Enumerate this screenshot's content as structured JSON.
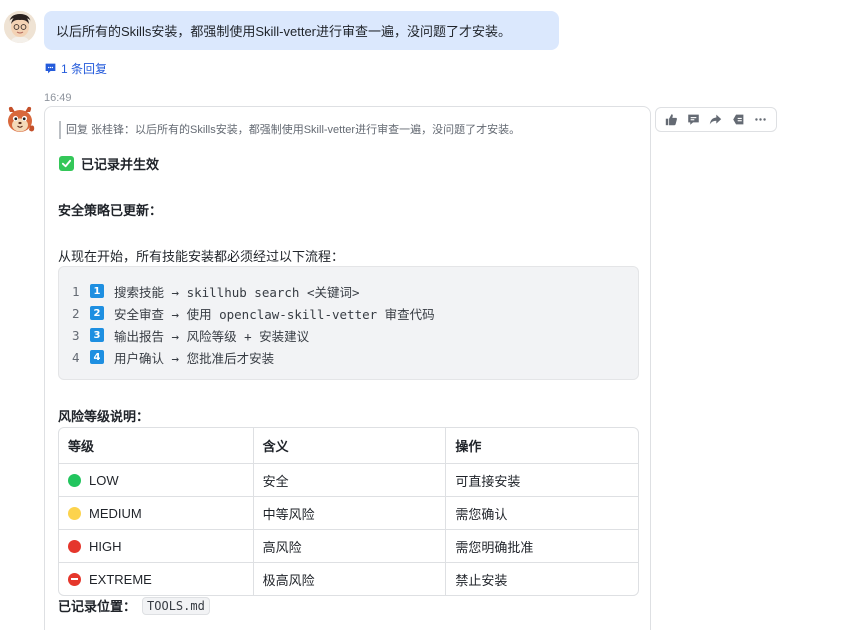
{
  "user_message": {
    "text": "以后所有的Skills安装，都强制使用Skill-vetter进行审查一遍，没问题了才安装。",
    "reply_link": "1 条回复"
  },
  "timestamp": "16:49",
  "bot_message": {
    "quote": "回复 张桂锋：以后所有的Skills安装，都强制使用Skill-vetter进行审查一遍，没问题了才安装。",
    "recorded_title": "已记录并生效",
    "policy_heading": "安全策略已更新：",
    "flow_intro": "从现在开始，所有技能安装都必须经过以下流程：",
    "code_lines": [
      {
        "num": "1",
        "key": "1",
        "text": "搜索技能 → skillhub search <关键词>"
      },
      {
        "num": "2",
        "key": "2",
        "text": "安全审查 → 使用 openclaw-skill-vetter 审查代码"
      },
      {
        "num": "3",
        "key": "3",
        "text": "输出报告 → 风险等级 + 安装建议"
      },
      {
        "num": "4",
        "key": "4",
        "text": "用户确认 → 您批准后才安装"
      }
    ],
    "risk_heading": "风险等级说明：",
    "risk_table": {
      "headers": [
        "等级",
        "含义",
        "操作"
      ],
      "rows": [
        {
          "level": "LOW",
          "color": "#22c55e",
          "meaning": "安全",
          "action": "可直接安装"
        },
        {
          "level": "MEDIUM",
          "color": "#fcd34d",
          "meaning": "中等风险",
          "action": "需您确认"
        },
        {
          "level": "HIGH",
          "color": "#e5372c",
          "meaning": "高风险",
          "action": "需您明确批准"
        },
        {
          "level": "EXTREME",
          "color": "#e5372c",
          "meaning": "极高风险",
          "action": "禁止安装"
        }
      ]
    },
    "location_label": "已记录位置：",
    "location_file": "TOOLS.md"
  },
  "actions": [
    "thumbs-up-icon",
    "comment-icon",
    "forward-icon",
    "pin-icon",
    "more-icon"
  ]
}
